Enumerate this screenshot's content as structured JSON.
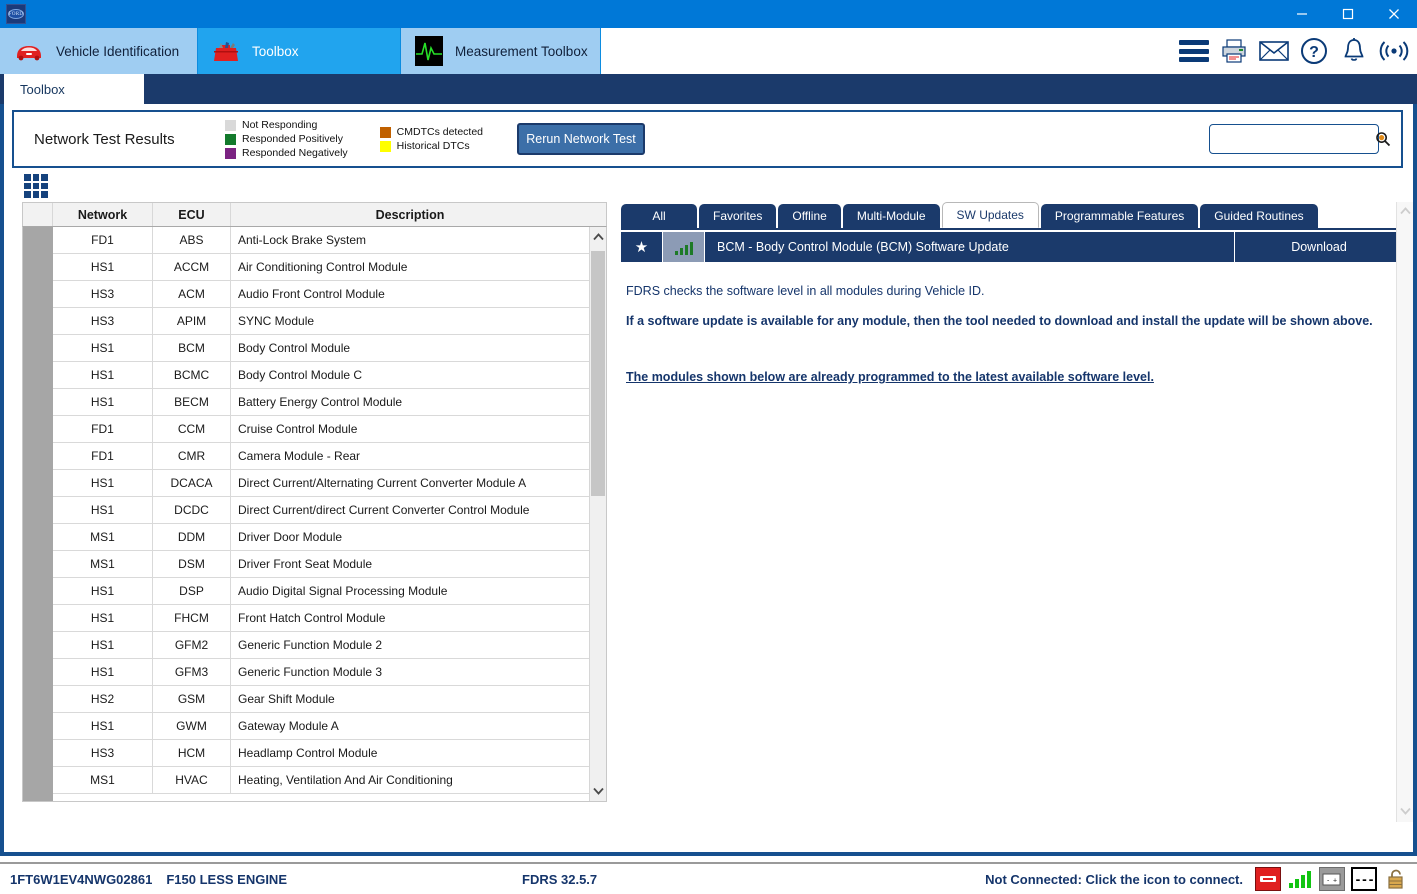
{
  "window": {
    "app_icon": "ford-logo-icon",
    "minimize": "—",
    "maximize": "□",
    "close": "✕"
  },
  "nav_tabs": [
    {
      "label": "Vehicle Identification",
      "icon": "car-icon",
      "active": false
    },
    {
      "label": "Toolbox",
      "icon": "toolbox-icon",
      "active": true
    },
    {
      "label": "Measurement Toolbox",
      "icon": "oscilloscope-icon",
      "active": false
    }
  ],
  "header_icons": [
    {
      "name": "menu-icon",
      "glyph": ""
    },
    {
      "name": "printer-icon",
      "glyph": ""
    },
    {
      "name": "mail-icon",
      "glyph": ""
    },
    {
      "name": "help-icon",
      "glyph": "?"
    },
    {
      "name": "notifications-bell-icon",
      "glyph": ""
    },
    {
      "name": "broadcast-icon",
      "glyph": ""
    }
  ],
  "subtab": {
    "label": "Toolbox"
  },
  "network_test": {
    "title": "Network Test Results",
    "legend_left": [
      {
        "label": "Not Responding",
        "color": "#d9d9d9"
      },
      {
        "label": "Responded Positively",
        "color": "#137a2c"
      },
      {
        "label": "Responded Negatively",
        "color": "#7b2382"
      }
    ],
    "legend_right": [
      {
        "label": "CMDTCs detected",
        "color": "#c06000"
      },
      {
        "label": "Historical DTCs",
        "color": "#ffff00"
      }
    ],
    "rerun_button": "Rerun Network Test",
    "search_value": "",
    "search_placeholder": ""
  },
  "grid_icon": "grid-view-icon",
  "table": {
    "columns": [
      "",
      "Network",
      "ECU",
      "Description"
    ],
    "rows": [
      {
        "status": "",
        "network": "FD1",
        "ecu": "ABS",
        "description": "Anti-Lock Brake System"
      },
      {
        "status": "",
        "network": "HS1",
        "ecu": "ACCM",
        "description": "Air Conditioning Control Module"
      },
      {
        "status": "",
        "network": "HS3",
        "ecu": "ACM",
        "description": "Audio Front Control Module"
      },
      {
        "status": "",
        "network": "HS3",
        "ecu": "APIM",
        "description": "SYNC Module"
      },
      {
        "status": "",
        "network": "HS1",
        "ecu": "BCM",
        "description": "Body Control Module"
      },
      {
        "status": "",
        "network": "HS1",
        "ecu": "BCMC",
        "description": "Body Control Module C"
      },
      {
        "status": "",
        "network": "HS1",
        "ecu": "BECM",
        "description": "Battery Energy Control Module"
      },
      {
        "status": "",
        "network": "FD1",
        "ecu": "CCM",
        "description": "Cruise Control Module"
      },
      {
        "status": "",
        "network": "FD1",
        "ecu": "CMR",
        "description": "Camera Module - Rear"
      },
      {
        "status": "",
        "network": "HS1",
        "ecu": "DCACA",
        "description": "Direct Current/Alternating Current Converter Module A"
      },
      {
        "status": "",
        "network": "HS1",
        "ecu": "DCDC",
        "description": "Direct Current/direct Current Converter Control Module"
      },
      {
        "status": "",
        "network": "MS1",
        "ecu": "DDM",
        "description": "Driver Door Module"
      },
      {
        "status": "",
        "network": "MS1",
        "ecu": "DSM",
        "description": "Driver Front Seat Module"
      },
      {
        "status": "",
        "network": "HS1",
        "ecu": "DSP",
        "description": "Audio Digital Signal Processing Module"
      },
      {
        "status": "",
        "network": "HS1",
        "ecu": "FHCM",
        "description": "Front Hatch Control Module"
      },
      {
        "status": "",
        "network": "HS1",
        "ecu": "GFM2",
        "description": "Generic Function Module 2"
      },
      {
        "status": "",
        "network": "HS1",
        "ecu": "GFM3",
        "description": "Generic Function Module 3"
      },
      {
        "status": "",
        "network": "HS2",
        "ecu": "GSM",
        "description": "Gear Shift Module"
      },
      {
        "status": "",
        "network": "HS1",
        "ecu": "GWM",
        "description": "Gateway Module A"
      },
      {
        "status": "",
        "network": "HS3",
        "ecu": "HCM",
        "description": "Headlamp Control Module"
      },
      {
        "status": "",
        "network": "MS1",
        "ecu": "HVAC",
        "description": "Heating, Ventilation And Air Conditioning"
      }
    ]
  },
  "right_panel": {
    "tabs": [
      {
        "label": "All",
        "active": false
      },
      {
        "label": "Favorites",
        "active": false
      },
      {
        "label": "Offline",
        "active": false
      },
      {
        "label": "Multi-Module",
        "active": false
      },
      {
        "label": "SW Updates",
        "active": true
      },
      {
        "label": "Programmable Features",
        "active": false
      },
      {
        "label": "Guided Routines",
        "active": false
      }
    ],
    "update_row": {
      "star_icon": "star-icon",
      "signal_icon": "signal-bars-icon",
      "label": "BCM - Body Control Module (BCM) Software Update",
      "action": "Download"
    },
    "lines": [
      "FDRS checks the software level in all modules during Vehicle ID.",
      "If a software update is available for any module, then the tool needed to download and install the update will be shown above."
    ],
    "link": "The modules shown below are already programmed to the latest available software level."
  },
  "statusbar": {
    "vin": "1FT6W1EV4NWG02861",
    "model": "F150 LESS ENGINE",
    "version": "FDRS 32.5.7",
    "connection_message": "Not Connected: Click the icon to connect.",
    "icons": [
      {
        "name": "vci-icon",
        "color": "#e02020"
      },
      {
        "name": "signal-strength-icon",
        "color": "#12c412"
      },
      {
        "name": "battery-icon",
        "color": "#9a9a9a"
      },
      {
        "name": "dashes-icon",
        "label": "- - -"
      },
      {
        "name": "unlock-icon",
        "color": "#c9913f"
      }
    ]
  },
  "colors": {
    "brand_blue": "#0078d7",
    "nav_active": "#21a4ee",
    "nav_inactive": "#9fcdf2",
    "panel_navy": "#1b3a6b",
    "border_blue": "#16508f",
    "text_navy": "#15356b"
  }
}
